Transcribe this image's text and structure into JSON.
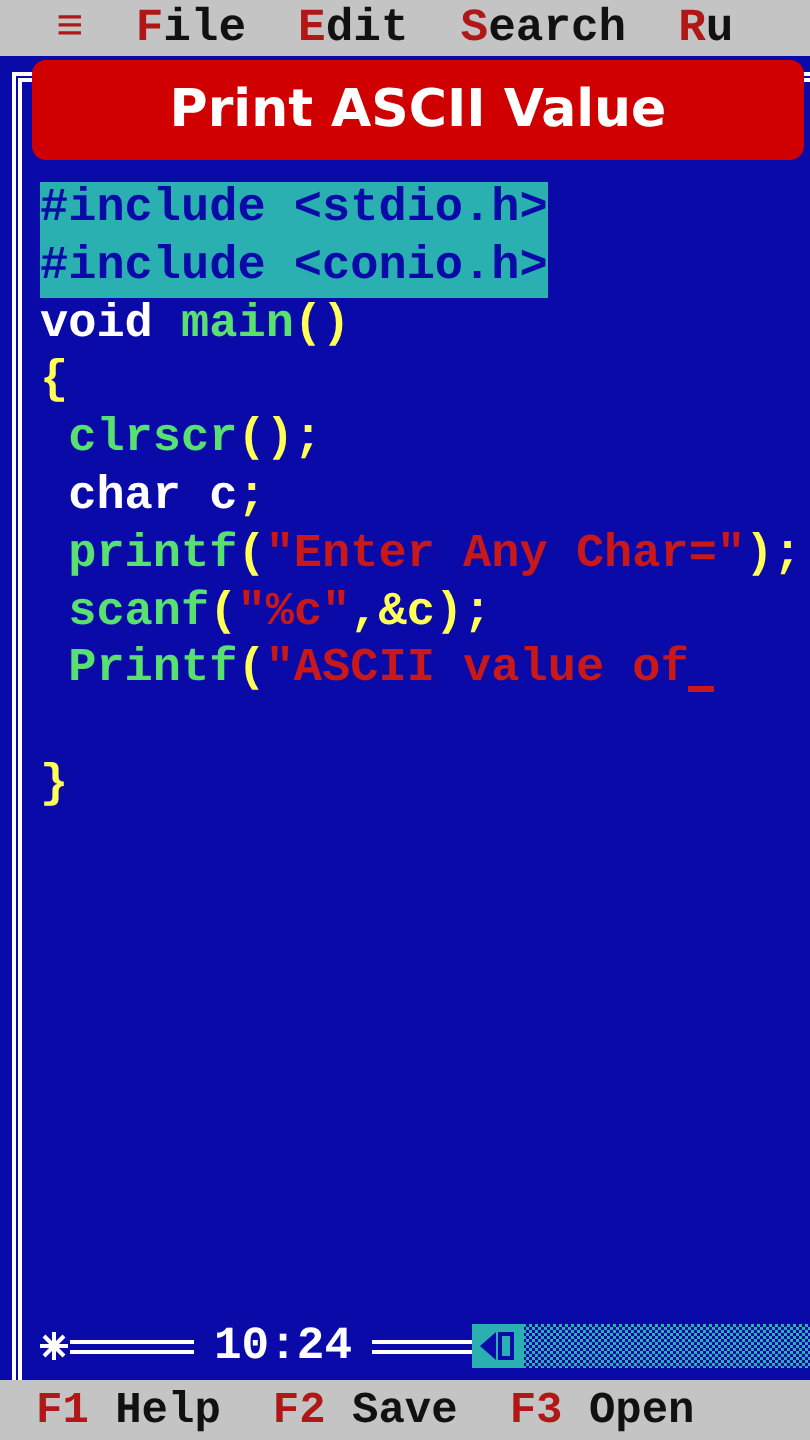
{
  "menu": [
    {
      "hotkey": "≡"
    },
    {
      "hotkey": "F",
      "rest": "ile"
    },
    {
      "hotkey": "E",
      "rest": "dit"
    },
    {
      "hotkey": "S",
      "rest": "earch"
    },
    {
      "hotkey": "R",
      "rest": "u"
    }
  ],
  "banner": {
    "title": "Print ASCII Value"
  },
  "editor": {
    "lines": [
      {
        "selected": true,
        "cursor": false,
        "segments": [
          {
            "kind": "directive",
            "text": "#include <stdio.h>"
          }
        ]
      },
      {
        "selected": true,
        "cursor": false,
        "segments": [
          {
            "kind": "directive",
            "text": "#include <conio.h>"
          }
        ]
      },
      {
        "selected": false,
        "cursor": false,
        "segments": [
          {
            "kind": "keyword",
            "text": "void "
          },
          {
            "kind": "ident",
            "text": "main"
          },
          {
            "kind": "punct",
            "text": "()"
          }
        ]
      },
      {
        "selected": false,
        "cursor": false,
        "segments": [
          {
            "kind": "punct",
            "text": "{"
          }
        ]
      },
      {
        "selected": false,
        "cursor": false,
        "segments": [
          {
            "kind": "ident",
            "text": " clrscr"
          },
          {
            "kind": "punct",
            "text": "();"
          }
        ]
      },
      {
        "selected": false,
        "cursor": false,
        "segments": [
          {
            "kind": "keyword",
            "text": " char c"
          },
          {
            "kind": "punct",
            "text": ";"
          }
        ]
      },
      {
        "selected": false,
        "cursor": false,
        "segments": [
          {
            "kind": "ident",
            "text": " printf"
          },
          {
            "kind": "punct",
            "text": "("
          },
          {
            "kind": "string",
            "text": "\"Enter Any Char=\""
          },
          {
            "kind": "punct",
            "text": ");"
          }
        ]
      },
      {
        "selected": false,
        "cursor": false,
        "segments": [
          {
            "kind": "ident",
            "text": " scanf"
          },
          {
            "kind": "punct",
            "text": "("
          },
          {
            "kind": "string",
            "text": "\"%c\""
          },
          {
            "kind": "punct",
            "text": ",&c);"
          }
        ]
      },
      {
        "selected": false,
        "cursor": true,
        "segments": [
          {
            "kind": "ident",
            "text": " Printf"
          },
          {
            "kind": "punct",
            "text": "("
          },
          {
            "kind": "string",
            "text": "\"ASCII value of"
          }
        ]
      },
      {
        "selected": false,
        "cursor": false
      },
      {
        "selected": false,
        "cursor": false,
        "segments": [
          {
            "kind": "punct",
            "text": "}"
          }
        ]
      }
    ],
    "position": "10:24"
  },
  "footer": [
    {
      "key": "F1",
      "label": "Help"
    },
    {
      "key": "F2",
      "label": "Save"
    },
    {
      "key": "F3",
      "label": "Open"
    }
  ]
}
